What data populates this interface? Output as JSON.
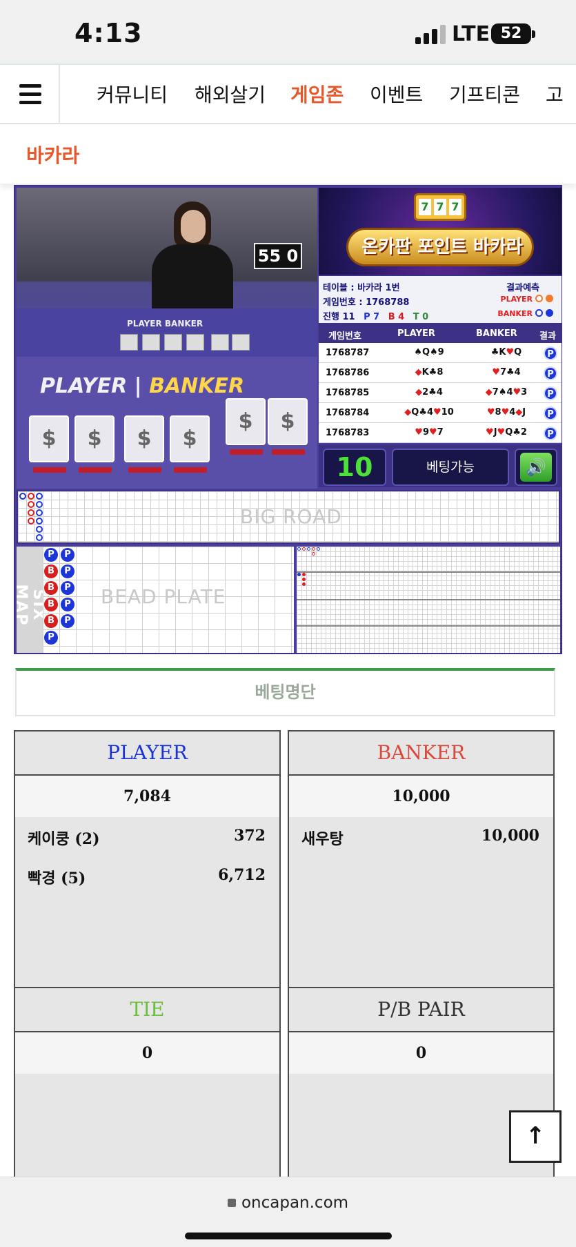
{
  "status_bar": {
    "time": "4:13",
    "network": "LTE",
    "battery": "52"
  },
  "nav": {
    "items": [
      "커뮤니티",
      "해외살기",
      "게임존",
      "이벤트",
      "기프티콘",
      "고"
    ],
    "active_index": 2
  },
  "page_title": "바카라",
  "game": {
    "video": {
      "score_sign": "55 0",
      "felt_small": "PLAYER  BANKER",
      "felt_player": "PLAYER",
      "felt_banker": "BANKER"
    },
    "banner": {
      "title": "온카판 포인트 바카라",
      "slot": [
        "7",
        "7",
        "7"
      ]
    },
    "info": {
      "table": "테이블 : 바카라 1번",
      "game_no": "게임번호 : 1768788",
      "progress_label": "진행 11",
      "p_count": "P 7",
      "b_count": "B 4",
      "t_count": "T 0",
      "predict_label": "결과예측",
      "player_label": "PLAYER",
      "banker_label": "BANKER"
    },
    "results": {
      "headers": [
        "게임번호",
        "PLAYER",
        "BANKER",
        "결과"
      ],
      "rows": [
        {
          "no": "1768787",
          "player": "♠Q♠9",
          "banker": "♣K♥Q",
          "result": "P"
        },
        {
          "no": "1768786",
          "player": "◆K♣8",
          "banker": "♥7♣4",
          "result": "P"
        },
        {
          "no": "1768785",
          "player": "◆2♣4",
          "banker": "◆7♠4♥3",
          "result": "P"
        },
        {
          "no": "1768784",
          "player": "◆Q♣4♥10",
          "banker": "♥8♥4◆J",
          "result": "P"
        },
        {
          "no": "1768783",
          "player": "♥9♥7",
          "banker": "♥J♥Q♣2",
          "result": "P"
        }
      ]
    },
    "countdown": "10",
    "bet_status": "베팅가능",
    "big_road_label": "BIG ROAD",
    "six_map_label": "SIX MAP",
    "bead_plate_label": "BEAD PLATE",
    "bead_plate": [
      [
        "P",
        "B",
        "B",
        "B",
        "B",
        "P"
      ],
      [
        "P",
        "P",
        "P",
        "P",
        "P"
      ]
    ]
  },
  "betting": {
    "title": "베팅명단",
    "player": {
      "label": "PLAYER",
      "total": "7,084",
      "rows": [
        {
          "name": "케이쿵 (2)",
          "amount": "372"
        },
        {
          "name": "빡경 (5)",
          "amount": "6,712"
        }
      ]
    },
    "banker": {
      "label": "BANKER",
      "total": "10,000",
      "rows": [
        {
          "name": "새우탕",
          "amount": "10,000"
        }
      ]
    },
    "tie": {
      "label": "TIE",
      "total": "0"
    },
    "pair": {
      "label": "P/B PAIR",
      "total": "0"
    }
  },
  "colors": {
    "accent": "#e8572a",
    "player": "#1a33d6",
    "banker": "#d9483b",
    "tie": "#6bbf3a",
    "pair": "#333333"
  },
  "to_top_icon": "arrow-up-icon",
  "browser": {
    "url": "oncapan.com"
  }
}
